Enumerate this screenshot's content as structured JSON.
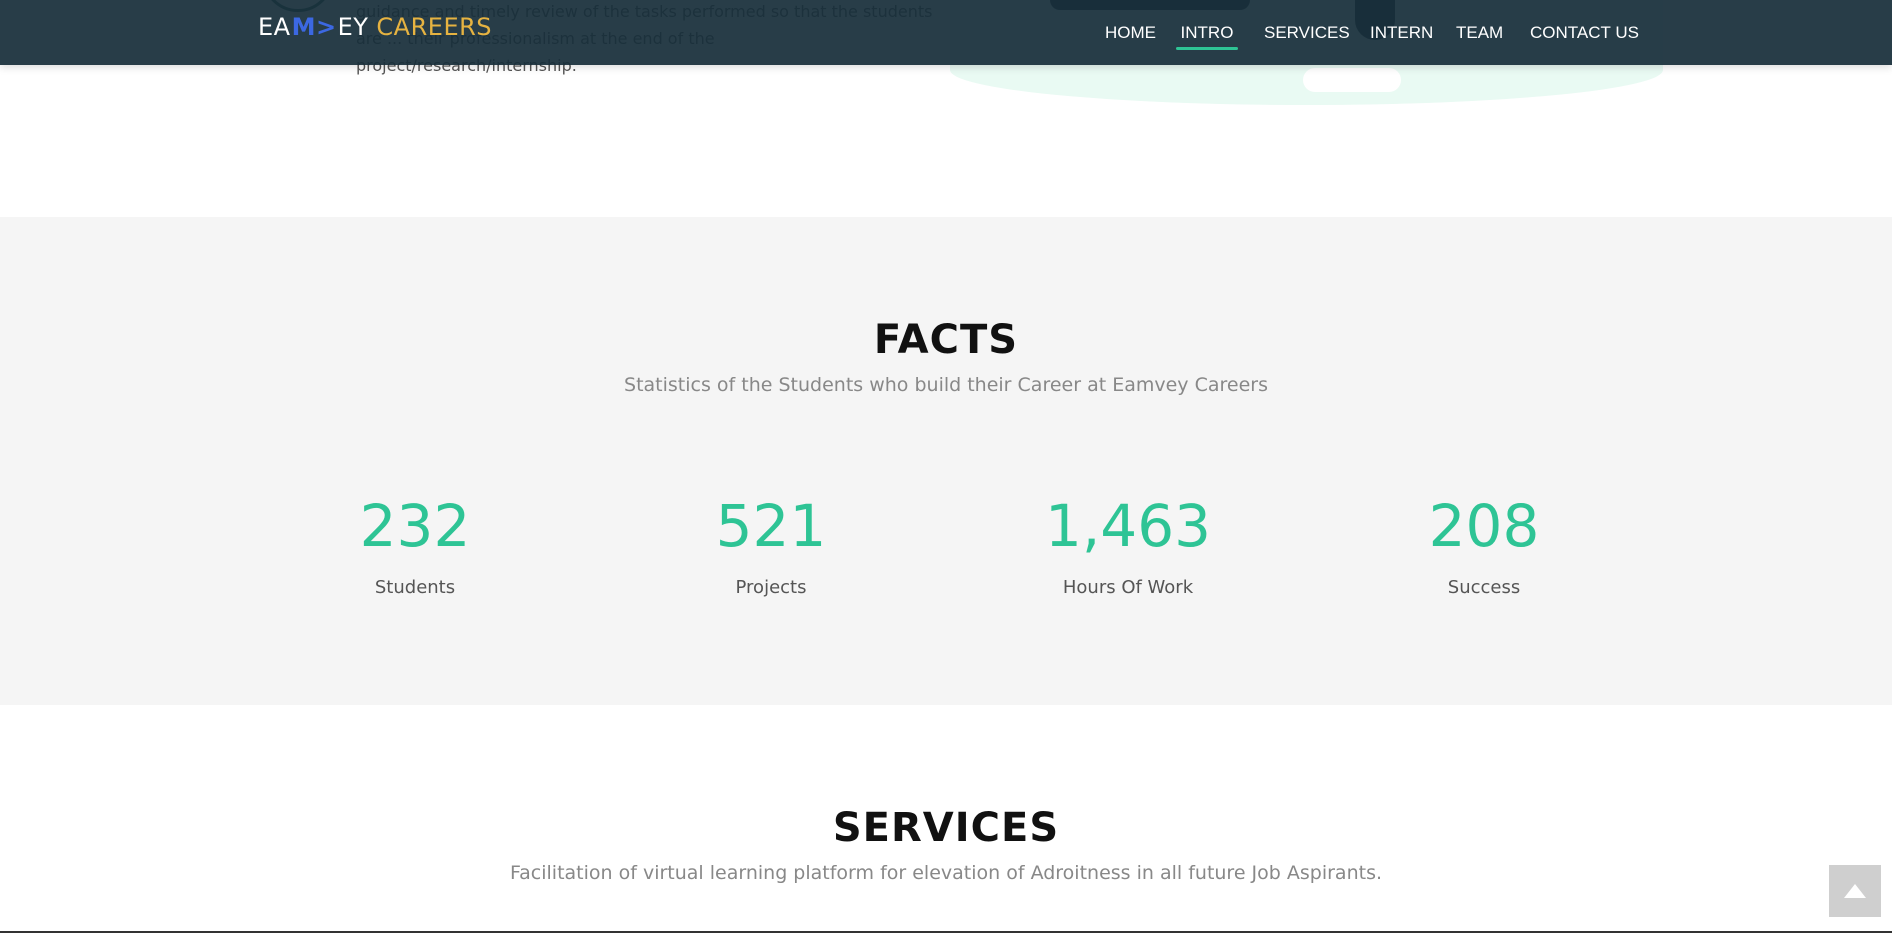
{
  "intro": {
    "text": "guidance and timely review of the tasks performed so that the students are ... their professionalism at the end of the project/research/internship."
  },
  "header": {
    "logo_brand": "EA",
    "logo_mark": "M>",
    "logo_rest": "EY",
    "logo_accent": "CAREERS",
    "nav": [
      {
        "label": "HOME",
        "active": false
      },
      {
        "label": "INTRO",
        "active": true
      },
      {
        "label": "SERVICES",
        "active": false
      },
      {
        "label": "INTERN",
        "active": false
      },
      {
        "label": "TEAM",
        "active": false
      },
      {
        "label": "CONTACT US",
        "active": false
      }
    ]
  },
  "facts": {
    "title": "FACTS",
    "subtitle": "Statistics of the Students who build their Career at Eamvey Careers",
    "stats": [
      {
        "value": "232",
        "label": "Students"
      },
      {
        "value": "521",
        "label": "Projects"
      },
      {
        "value": "1,463",
        "label": "Hours Of Work"
      },
      {
        "value": "208",
        "label": "Success"
      }
    ]
  },
  "services": {
    "title": "SERVICES",
    "subtitle": "Facilitation of virtual learning platform for elevation of Adroitness in all future Job Aspirants."
  },
  "colors": {
    "header_bg": "#182e3a",
    "accent_green": "#2ec495",
    "logo_gold": "#e6b341",
    "logo_blue": "#3c68e2",
    "facts_bg": "#f5f5f5"
  },
  "icons": {
    "back_to_top": "chevron-up-icon"
  }
}
